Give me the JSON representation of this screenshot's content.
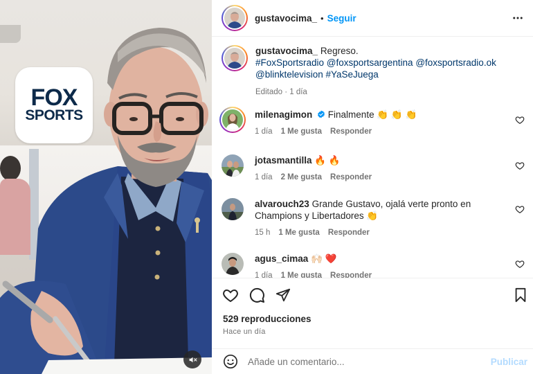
{
  "post": {
    "author": "gustavocima_",
    "dot": "•",
    "follow_label": "Seguir",
    "more_icon": "more-horizontal-icon",
    "caption_text": "Regreso.",
    "caption_tags_line1": "#FoxSportsradio @foxsportsargentina @foxsportsradio.ok",
    "caption_tags_line2": "@blinktelevision #YaSeJuega",
    "edited_meta": "Editado · 1 día"
  },
  "media": {
    "logo_line1": "FOX",
    "logo_line2": "SPORTS",
    "mute_icon": "volume-muted-icon"
  },
  "comments": [
    {
      "user": "milenagimon",
      "verified": true,
      "text": "Finalmente 👏 👏 👏",
      "age": "1 día",
      "likes": "1 Me gusta",
      "reply": "Responder"
    },
    {
      "user": "jotasmantilla",
      "verified": false,
      "text": "🔥 🔥",
      "age": "1 día",
      "likes": "2 Me gusta",
      "reply": "Responder"
    },
    {
      "user": "alvarouch23",
      "verified": false,
      "text": "Grande Gustavo, ojalá verte pronto en Champions y Libertadores 👏",
      "age": "15 h",
      "likes": "1 Me gusta",
      "reply": "Responder"
    },
    {
      "user": "agus_cimaa",
      "verified": false,
      "text": "🙌🏻 ❤️",
      "age": "1 día",
      "likes": "1 Me gusta",
      "reply": "Responder"
    }
  ],
  "actions": {
    "views": "529 reproducciones",
    "time_ago": "Hace un día"
  },
  "composer": {
    "placeholder": "Añade un comentario...",
    "post_label": "Publicar"
  },
  "colors": {
    "link_blue": "#0095f6",
    "tag_blue": "#00376b",
    "muted_text": "#737373",
    "disabled_post": "#b3dbff",
    "verified_blue": "#0095f6"
  }
}
